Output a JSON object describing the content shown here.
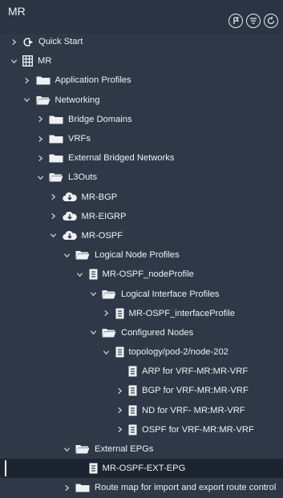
{
  "window": {
    "title": "MR"
  },
  "header_icons": [
    {
      "name": "pin-icon"
    },
    {
      "name": "filter-icon"
    },
    {
      "name": "refresh-icon"
    }
  ],
  "tree": [
    {
      "id": "quick-start",
      "label": "Quick Start",
      "depth": 0,
      "chevron": "right",
      "icon": "quickstart"
    },
    {
      "id": "mr",
      "label": "MR",
      "depth": 0,
      "chevron": "down",
      "icon": "tenant"
    },
    {
      "id": "application-profiles",
      "label": "Application Profiles",
      "depth": 1,
      "chevron": "right",
      "icon": "folder"
    },
    {
      "id": "networking",
      "label": "Networking",
      "depth": 1,
      "chevron": "down",
      "icon": "folder-open"
    },
    {
      "id": "bridge-domains",
      "label": "Bridge Domains",
      "depth": 2,
      "chevron": "right",
      "icon": "folder"
    },
    {
      "id": "vrfs",
      "label": "VRFs",
      "depth": 2,
      "chevron": "right",
      "icon": "folder"
    },
    {
      "id": "external-bridged-networks",
      "label": "External Bridged Networks",
      "depth": 2,
      "chevron": "right",
      "icon": "folder"
    },
    {
      "id": "l3outs",
      "label": "L3Outs",
      "depth": 2,
      "chevron": "down",
      "icon": "folder-open"
    },
    {
      "id": "mr-bgp",
      "label": "MR-BGP",
      "depth": 3,
      "chevron": "right",
      "icon": "cloud"
    },
    {
      "id": "mr-eigrp",
      "label": "MR-EIGRP",
      "depth": 3,
      "chevron": "right",
      "icon": "cloud"
    },
    {
      "id": "mr-ospf",
      "label": "MR-OSPF",
      "depth": 3,
      "chevron": "down",
      "icon": "cloud"
    },
    {
      "id": "logical-node-profiles",
      "label": "Logical Node Profiles",
      "depth": 4,
      "chevron": "down",
      "icon": "folder-open"
    },
    {
      "id": "mr-ospf-nodeprofile",
      "label": "MR-OSPF_nodeProfile",
      "depth": 5,
      "chevron": "down",
      "icon": "doc"
    },
    {
      "id": "logical-interface-profiles",
      "label": "Logical Interface Profiles",
      "depth": 6,
      "chevron": "down",
      "icon": "folder-open"
    },
    {
      "id": "mr-ospf-interfaceprofile",
      "label": "MR-OSPF_interfaceProfile",
      "depth": 7,
      "chevron": "right",
      "icon": "doc"
    },
    {
      "id": "configured-nodes",
      "label": "Configured Nodes",
      "depth": 6,
      "chevron": "down",
      "icon": "folder-open"
    },
    {
      "id": "topology-pod-2-node-202",
      "label": "topology/pod-2/node-202",
      "depth": 7,
      "chevron": "down",
      "icon": "doc"
    },
    {
      "id": "arp-for-vrf",
      "label": "ARP for VRF-MR:MR-VRF",
      "depth": 8,
      "chevron": "none",
      "icon": "doc"
    },
    {
      "id": "bgp-for-vrf",
      "label": "BGP for VRF-MR:MR-VRF",
      "depth": 8,
      "chevron": "right",
      "icon": "doc"
    },
    {
      "id": "nd-for-vrf",
      "label": "ND for VRF- MR:MR-VRF",
      "depth": 8,
      "chevron": "right",
      "icon": "doc"
    },
    {
      "id": "ospf-for-vrf",
      "label": "OSPF for VRF-MR:MR-VRF",
      "depth": 8,
      "chevron": "right",
      "icon": "doc"
    },
    {
      "id": "external-epgs",
      "label": "External EPGs",
      "depth": 4,
      "chevron": "down",
      "icon": "folder-open"
    },
    {
      "id": "mr-ospf-ext-epg",
      "label": "MR-OSPF-EXT-EPG",
      "depth": 5,
      "chevron": "none",
      "icon": "doc",
      "selected": true
    },
    {
      "id": "route-map",
      "label": "Route map for import and export route control",
      "depth": 4,
      "chevron": "right",
      "icon": "folder"
    }
  ]
}
